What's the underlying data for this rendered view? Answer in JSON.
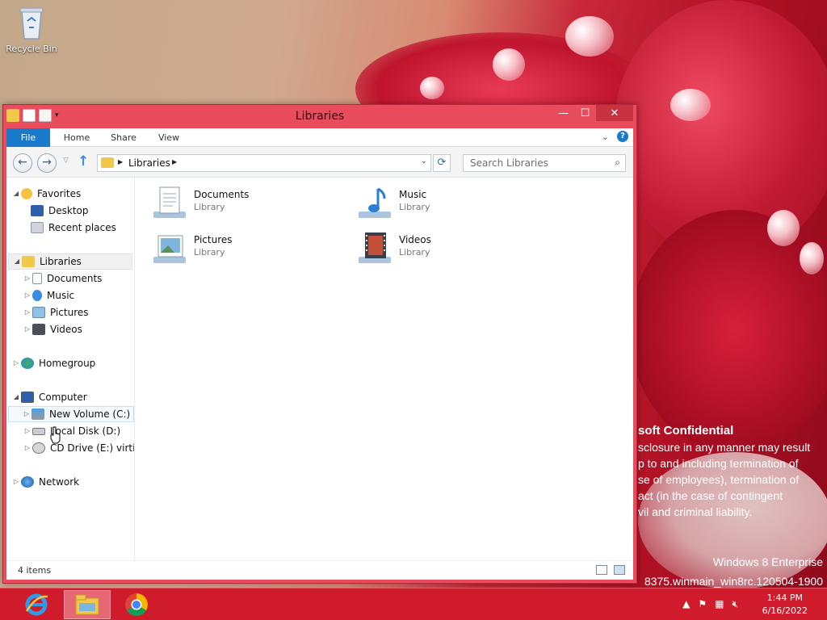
{
  "desktop": {
    "recycle_bin_label": "Recycle Bin"
  },
  "window": {
    "title": "Libraries",
    "ribbon_tabs": [
      "File",
      "Home",
      "Share",
      "View"
    ],
    "address_path": "Libraries",
    "search_placeholder": "Search Libraries",
    "controls": {
      "minimize": "—",
      "maximize": "☐",
      "close": "✕"
    }
  },
  "nav_pane": {
    "favorites": {
      "label": "Favorites",
      "children": [
        "Desktop",
        "Recent places"
      ]
    },
    "libraries": {
      "label": "Libraries",
      "children": [
        "Documents",
        "Music",
        "Pictures",
        "Videos"
      ]
    },
    "homegroup": "Homegroup",
    "computer": {
      "label": "Computer",
      "children": [
        "New Volume (C:)",
        "Local Disk (D:)",
        "CD Drive (E:) virtio-v"
      ]
    },
    "network": "Network"
  },
  "content": {
    "items": [
      {
        "name": "Documents",
        "type": "Library",
        "icon": "documents-library-icon"
      },
      {
        "name": "Music",
        "type": "Library",
        "icon": "music-library-icon"
      },
      {
        "name": "Pictures",
        "type": "Library",
        "icon": "pictures-library-icon"
      },
      {
        "name": "Videos",
        "type": "Library",
        "icon": "videos-library-icon"
      }
    ]
  },
  "status": {
    "item_count": "4 items"
  },
  "watermark": {
    "line1": "soft Confidential",
    "line2": "sclosure in any manner may result",
    "line3": "p to and including termination of",
    "line4": "se of employees), termination of",
    "line5": "act (in the case of contingent",
    "line6": "vil and criminal liability.",
    "edition": "Windows 8 Enterprise",
    "build": "8375.winmain_win8rc.120504-1900"
  },
  "taskbar": {
    "apps": [
      "internet-explorer-icon",
      "file-explorer-icon",
      "chrome-icon"
    ],
    "time": "1:44 PM",
    "date": "6/16/2022"
  },
  "colors": {
    "accent": "#1979ca",
    "window_frame": "#e94d5d",
    "taskbar": "#cf1b2b"
  }
}
